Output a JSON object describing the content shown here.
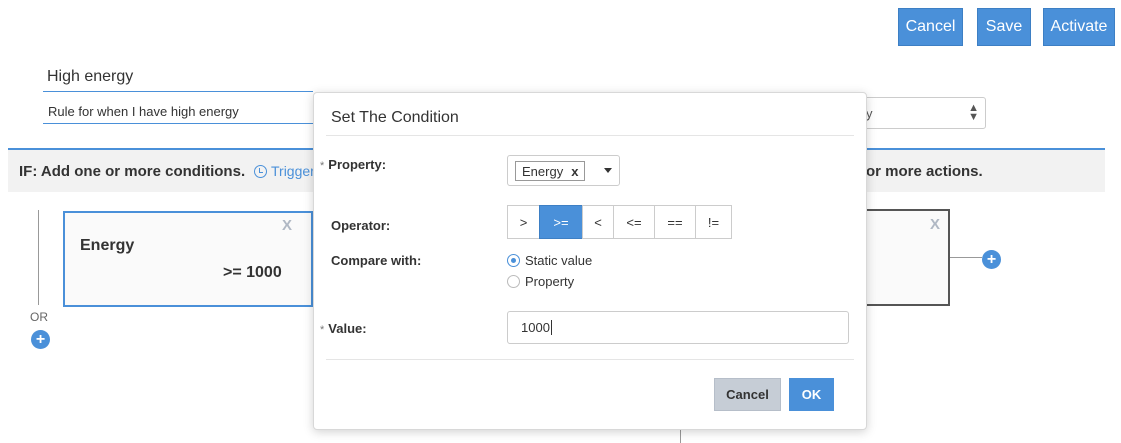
{
  "header": {
    "cancel_label": "Cancel",
    "save_label": "Save",
    "activate_label": "Activate"
  },
  "rule": {
    "name": "High energy",
    "description": "Rule for when I have high energy",
    "partial_select_value": "y"
  },
  "if_section": {
    "title": "IF: Add one or more conditions.",
    "trigger_label": "Trigger"
  },
  "then_section": {
    "title": "or more actions."
  },
  "condition_card": {
    "title": "Energy",
    "expression": ">= 1000",
    "remove_label": "X"
  },
  "action_card": {
    "remove_label": "X"
  },
  "or_label": "OR",
  "plus_glyph": "+",
  "modal": {
    "title": "Set The Condition",
    "required_mark": "*",
    "property_label": "Property:",
    "property_value": "Energy",
    "property_remove": "x",
    "operator_label": "Operator:",
    "operators": [
      ">",
      ">=",
      "<",
      "<=",
      "==",
      "!="
    ],
    "selected_operator": ">=",
    "compare_label": "Compare with:",
    "compare_options": [
      "Static value",
      "Property"
    ],
    "compare_selected": "Static value",
    "value_label": "Value:",
    "value": "1000",
    "cancel_label": "Cancel",
    "ok_label": "OK"
  },
  "colors": {
    "accent": "#4a90d9",
    "cancel_button_bg": "#c6cdd6",
    "bar_bg": "#f2f2f2"
  }
}
